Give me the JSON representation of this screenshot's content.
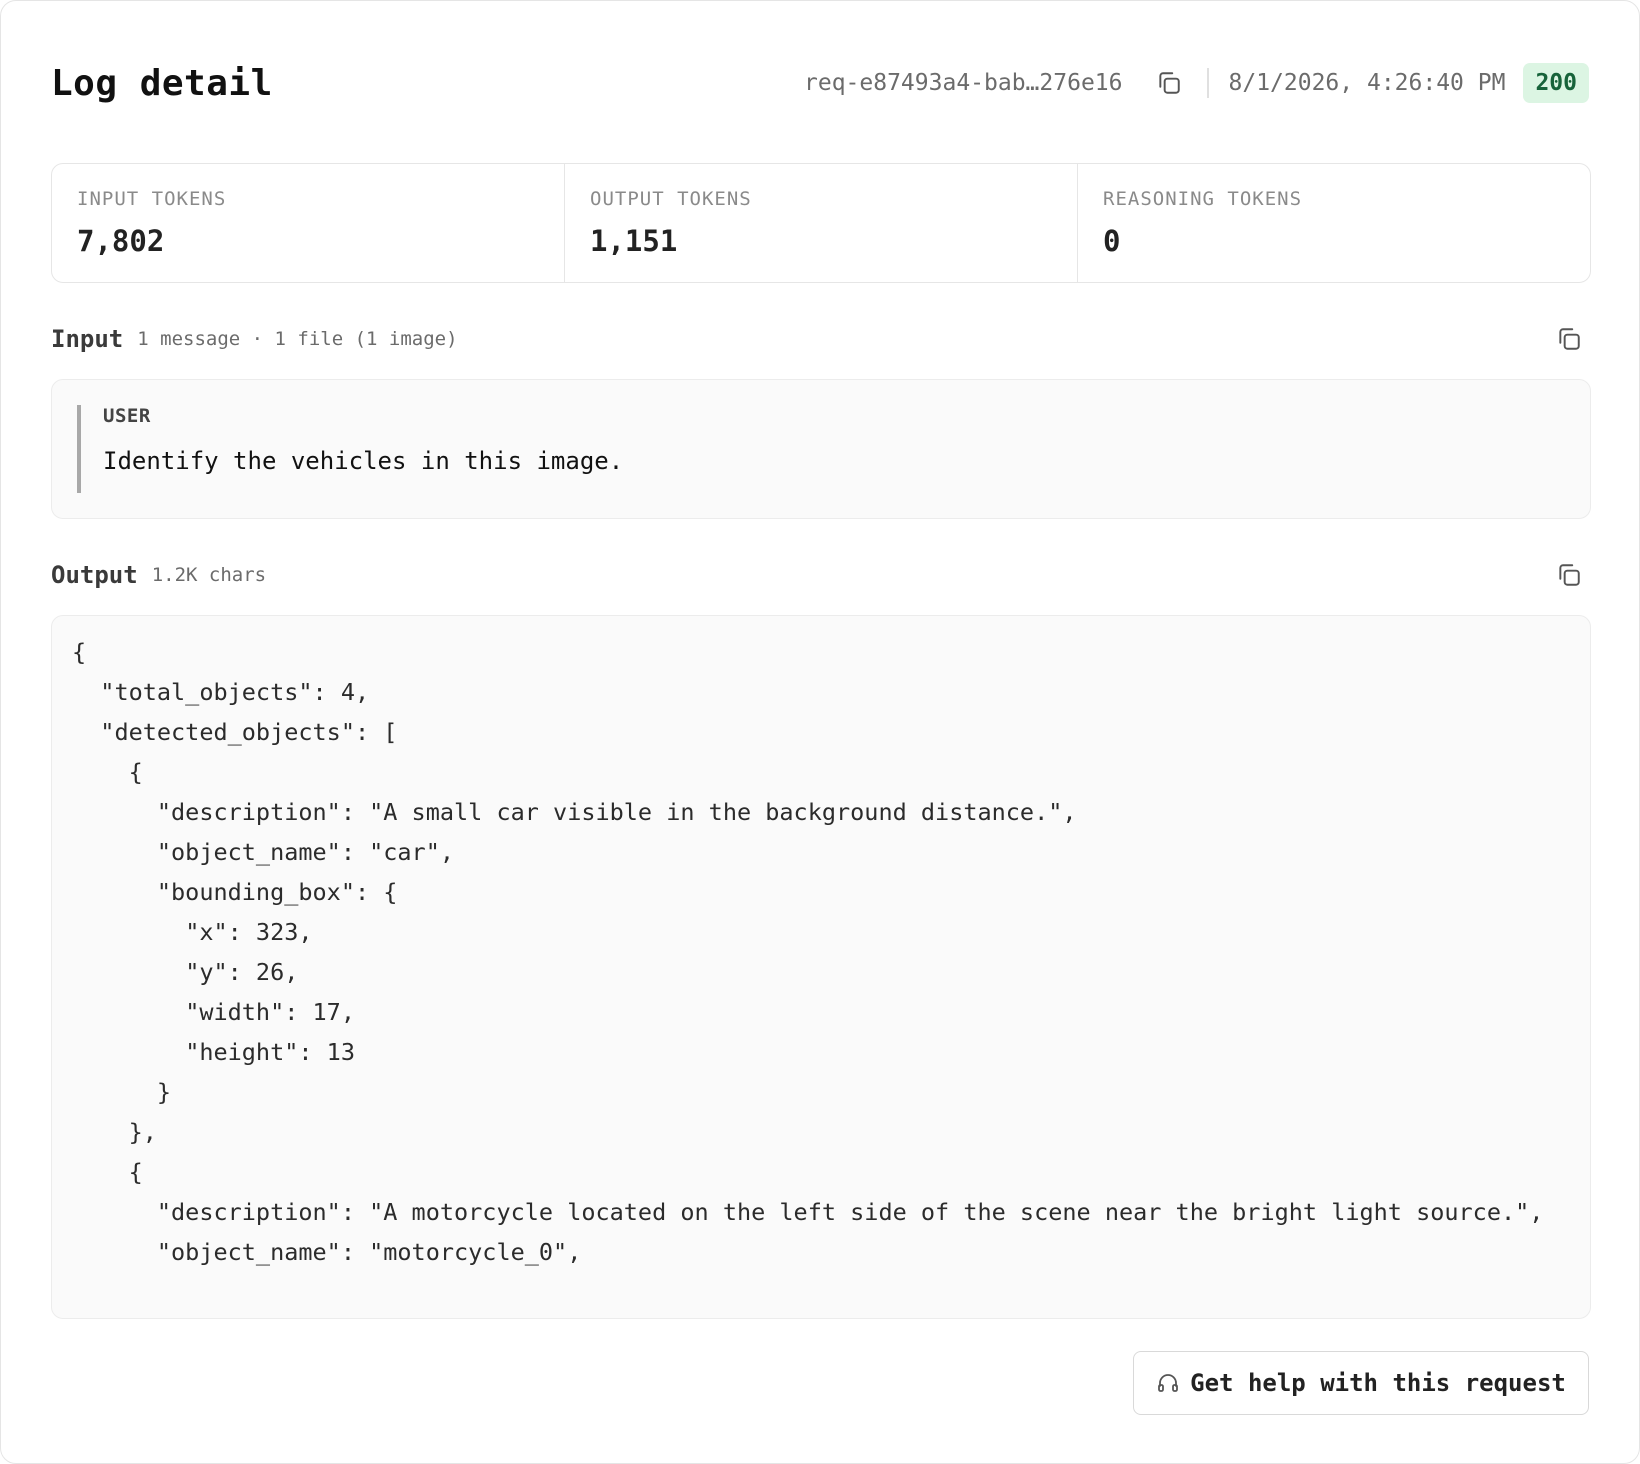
{
  "header": {
    "title": "Log detail",
    "request_id": "req-e87493a4-bab…276e16",
    "timestamp": "8/1/2026, 4:26:40 PM",
    "status_code": "200",
    "copy_icon": "copy-icon"
  },
  "stats": [
    {
      "label": "INPUT TOKENS",
      "value": "7,802"
    },
    {
      "label": "OUTPUT TOKENS",
      "value": "1,151"
    },
    {
      "label": "REASONING TOKENS",
      "value": "0"
    }
  ],
  "input": {
    "title": "Input",
    "meta": "1 message · 1 file (1 image)",
    "messages": [
      {
        "role": "USER",
        "text": "Identify the vehicles in this image."
      }
    ]
  },
  "output": {
    "title": "Output",
    "meta": "1.2K chars",
    "code": "{\n  \"total_objects\": 4,\n  \"detected_objects\": [\n    {\n      \"description\": \"A small car visible in the background distance.\",\n      \"object_name\": \"car\",\n      \"bounding_box\": {\n        \"x\": 323,\n        \"y\": 26,\n        \"width\": 17,\n        \"height\": 13\n      }\n    },\n    {\n      \"description\": \"A motorcycle located on the left side of the scene near the bright light source.\",\n      \"object_name\": \"motorcycle_0\","
  },
  "help_button": {
    "label": "Get help with this request",
    "icon": "headset-icon"
  },
  "colors": {
    "status_bg": "#dcf5e3",
    "status_text": "#17633a",
    "box_bg": "#fafafa",
    "border": "#e6e6e6"
  }
}
